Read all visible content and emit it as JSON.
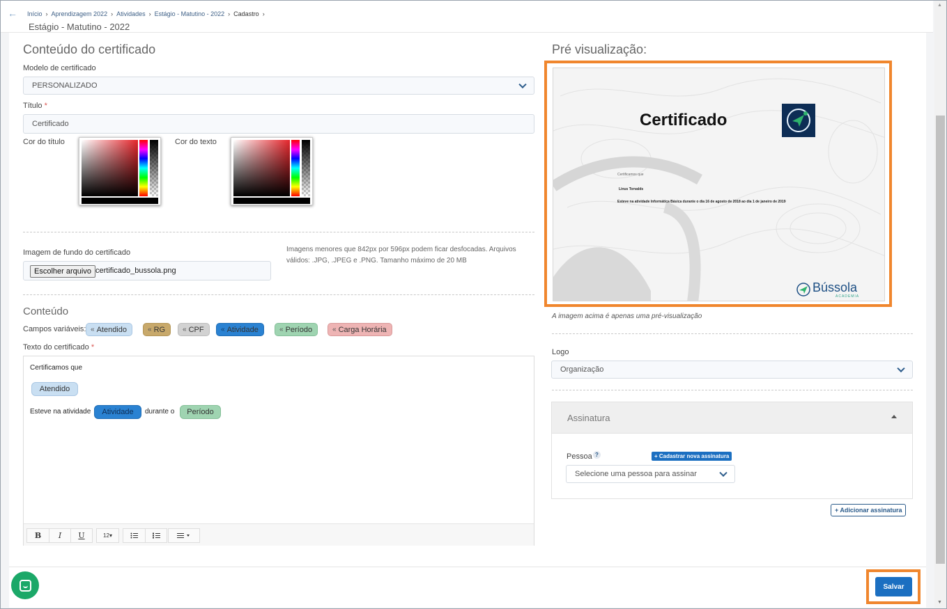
{
  "header": {
    "breadcrumb": [
      "Início",
      "Aprendizagem 2022",
      "Atividades",
      "Estágio - Matutino - 2022",
      "Cadastro"
    ],
    "page_subtitle": "Estágio - Matutino - 2022"
  },
  "content": {
    "section_title": "Conteúdo do certificado",
    "model_label": "Modelo de certificado",
    "model_value": "PERSONALIZADO",
    "title_label": "Título",
    "title_required": "*",
    "title_value": "Certificado",
    "title_color_label": "Cor do título",
    "text_color_label": "Cor do texto",
    "bg_image_label": "Imagem de fundo do certificado",
    "file_button": "Escolher arquivo",
    "file_name": "certificado_bussola.png",
    "bg_hint": "Imagens menores que 842px por 596px podem ficar desfocadas. Arquivos válidos: .JPG, .JPEG e .PNG. Tamanho máximo de 20 MB"
  },
  "conteudo": {
    "title": "Conteúdo",
    "vars_label": "Campos variáveis:",
    "chips": [
      "Atendido",
      "RG",
      "CPF",
      "Atividade",
      "Período",
      "Carga Horária"
    ],
    "text_label": "Texto do certificado",
    "text_required": "*",
    "editor": {
      "line1": "Certificamos que",
      "tag_atendido": "Atendido",
      "line3_prefix": "Esteve na atividade",
      "tag_atividade": "Atividade",
      "line3_mid": "durante o",
      "tag_periodo": "Período"
    },
    "toolbar": {
      "bold": "B",
      "italic": "I",
      "underline": "U",
      "font_size": "12",
      "bullets": "bullet-list-icon",
      "numbered": "numbered-list-icon",
      "align": "align-icon"
    }
  },
  "preview": {
    "title": "Pré visualização:",
    "cert_title": "Certificado",
    "cert_line1": "Certificamos que",
    "cert_name": "Linus Torvalds",
    "cert_line3": "Esteve na atividade  Informática Básica  durante o  dia 16 de agosto de 2018 ao dia 1 de janeiro de 2019",
    "brand": "Bússola",
    "brand_sub": "ACADEMIA",
    "note": "A imagem acima é apenas uma pré-visualização"
  },
  "logo": {
    "label": "Logo",
    "value": "Organização"
  },
  "signature": {
    "title": "Assinatura",
    "person_label": "Pessoa",
    "help": "?",
    "new_button": "+ Cadastrar nova assinatura",
    "person_placeholder": "Selecione uma pessoa para assinar",
    "add_button": "+ Adicionar assinatura"
  },
  "footer": {
    "save_label": "Salvar"
  },
  "colors": {
    "primary": "#1b6fc1",
    "highlight": "#f0862d",
    "chat": "#1ba868"
  }
}
